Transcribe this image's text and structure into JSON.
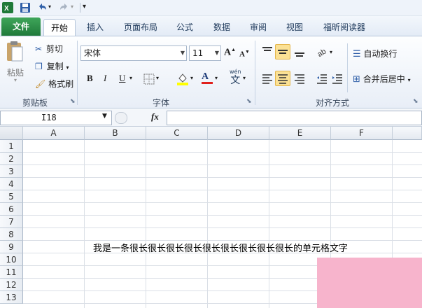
{
  "quick_access": {
    "save_icon": "save-icon",
    "undo_icon": "undo-icon",
    "redo_icon": "redo-icon",
    "customize": "▾"
  },
  "tabs": [
    {
      "label": "文件"
    },
    {
      "label": "开始"
    },
    {
      "label": "插入"
    },
    {
      "label": "页面布局"
    },
    {
      "label": "公式"
    },
    {
      "label": "数据"
    },
    {
      "label": "审阅"
    },
    {
      "label": "视图"
    },
    {
      "label": "福昕阅读器"
    }
  ],
  "clipboard": {
    "paste": "粘贴",
    "cut": "剪切",
    "copy": "复制",
    "format_painter": "格式刷",
    "group": "剪贴板"
  },
  "font": {
    "name": "宋体",
    "size": "11",
    "bold": "B",
    "italic": "I",
    "underline": "U",
    "font_color": "A",
    "wen": "wén",
    "wen2": "文",
    "grow": "A",
    "shrink": "A",
    "group": "字体"
  },
  "alignment": {
    "wrap": "自动换行",
    "merge": "合并后居中",
    "group": "对齐方式"
  },
  "formula_bar": {
    "name_box": "I18",
    "fx": "fx",
    "formula": ""
  },
  "sheet": {
    "columns": [
      "A",
      "B",
      "C",
      "D",
      "E",
      "F"
    ],
    "rows": [
      "1",
      "2",
      "3",
      "4",
      "5",
      "6",
      "7",
      "8",
      "9",
      "10",
      "11",
      "12",
      "13"
    ],
    "cell_text": "我是一条很长很长很长很长很长很长很长很长很长的单元格文字"
  },
  "colors": {
    "file_tab": "#2a8f47",
    "ribbon_bg": "#e8eef7",
    "watermark": "#f7b4cc"
  }
}
